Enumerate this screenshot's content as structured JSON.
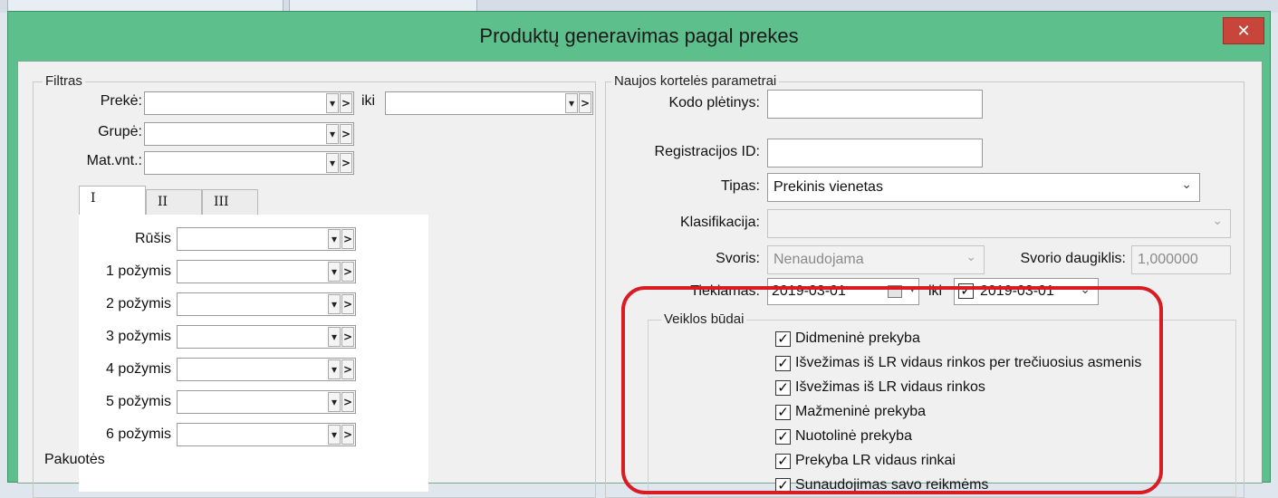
{
  "window": {
    "title": "Produktų generavimas pagal prekes",
    "close_symbol": "✕"
  },
  "filter": {
    "title": "Filtras",
    "preke_label": "Prekė:",
    "iki_label": "iki",
    "grupe_label": "Grupė:",
    "mat_label": "Mat.vnt.:",
    "dropdown_symbol": "▾",
    "next_symbol": ">",
    "tabs": [
      "I",
      "II",
      "III"
    ],
    "rusis_label": "Rūšis",
    "features": [
      "1 požymis",
      "2 požymis",
      "3 požymis",
      "4 požymis",
      "5 požymis",
      "6 požymis"
    ],
    "pakuotes_label": "Pakuotės"
  },
  "params": {
    "title": "Naujos kortelės parametrai",
    "kodo_label": "Kodo plėtinys:",
    "kodo_value": "",
    "reg_label": "Registracijos ID:",
    "reg_value": "",
    "tipas_label": "Tipas:",
    "tipas_value": "Prekinis vienetas",
    "klas_label": "Klasifikacija:",
    "klas_value": "",
    "svoris_label": "Svoris:",
    "svoris_value": "Nenaudojama",
    "daugiklis_label": "Svorio daugiklis:",
    "daugiklis_value": "1,000000",
    "tiek_label": "Tiekiamas:",
    "tiek_from": "2019-03-01",
    "tiek_iki": "iki",
    "tiek_to": "2019-03-01",
    "caret": "⌄",
    "cal_caret": "▾"
  },
  "activities": {
    "title": "Veiklos būdai",
    "check_mark": "✓",
    "items": [
      {
        "label": "Didmeninė prekyba",
        "checked": true
      },
      {
        "label": "Išvežimas iš LR vidaus rinkos per trečiuosius asmenis",
        "checked": true
      },
      {
        "label": "Išvežimas iš LR vidaus rinkos",
        "checked": true
      },
      {
        "label": "Mažmeninė prekyba",
        "checked": true
      },
      {
        "label": "Nuotolinė prekyba",
        "checked": true
      },
      {
        "label": "Prekyba LR vidaus rinkai",
        "checked": true
      },
      {
        "label": "Sunaudojimas savo reikmėms",
        "checked": true
      }
    ],
    "highlight_color": "#d91c24"
  },
  "colors": {
    "titlebar": "#5dbf8c",
    "close": "#c7453b",
    "panel": "#f0f0f0"
  }
}
